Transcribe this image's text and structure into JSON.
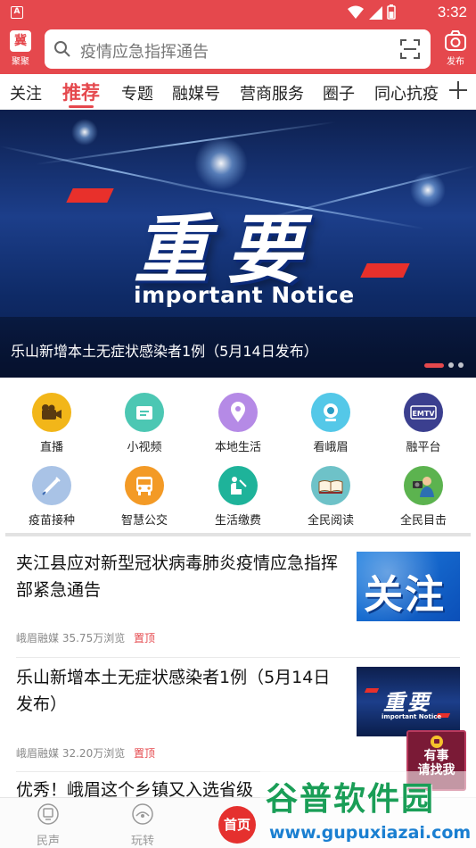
{
  "status_bar": {
    "app_badge": "A",
    "time": "3:32"
  },
  "header": {
    "logo_glyph": "冀",
    "logo_label": "聚聚",
    "search_placeholder": "疫情应急指挥通告",
    "publish_label": "发布"
  },
  "tabs": {
    "items": [
      "关注",
      "推荐",
      "专题",
      "融媒号",
      "营商服务",
      "圈子",
      "同心抗疫"
    ],
    "active": "推荐"
  },
  "banner": {
    "headline": "重要",
    "subtitle": "important Notice",
    "caption": "乐山新增本土无症状感染者1例（5月14日发布）",
    "slide_count": 3,
    "active_slide": 1
  },
  "shortcuts": [
    {
      "label": "直播",
      "icon": "camera-icon",
      "color": "#f2b619"
    },
    {
      "label": "小视频",
      "icon": "video-icon",
      "color": "#4cc7b3"
    },
    {
      "label": "本地生活",
      "icon": "location-icon",
      "color": "#b58ae6"
    },
    {
      "label": "看峨眉",
      "icon": "webcam-icon",
      "color": "#54c8e8"
    },
    {
      "label": "融平台",
      "icon": "tv-icon",
      "color": "#3b3f8f"
    },
    {
      "label": "疫苗接种",
      "icon": "syringe-icon",
      "color": "#a9c3e6"
    },
    {
      "label": "智慧公交",
      "icon": "bus-icon",
      "color": "#f39a26"
    },
    {
      "label": "生活缴费",
      "icon": "payment-icon",
      "color": "#1eb39a"
    },
    {
      "label": "全民阅读",
      "icon": "book-icon",
      "color": "#6ec2c8"
    },
    {
      "label": "全民目击",
      "icon": "reporter-icon",
      "color": "#5cb34f"
    }
  ],
  "news": [
    {
      "title": "夹江县应对新型冠状病毒肺炎疫情应急指挥部紧急通告",
      "source": "峨眉融媒",
      "views": "35.75万浏览",
      "pin": "置顶",
      "thumb_text": "关注"
    },
    {
      "title": "乐山新增本土无症状感染者1例（5月14日发布）",
      "source": "峨眉融媒",
      "views": "32.20万浏览",
      "pin": "置顶",
      "thumb_text": "重要",
      "thumb_sub": "important Notice"
    },
    {
      "title": "优秀！峨眉这个乡镇又入选省级"
    }
  ],
  "float_badge": {
    "line1": "有事",
    "line2": "请找我"
  },
  "bottom_nav": {
    "items": [
      {
        "label": "民声",
        "icon": "voice-icon"
      },
      {
        "label": "玩转",
        "icon": "explore-icon"
      }
    ],
    "home_label": "首页"
  },
  "watermark": {
    "title": "谷普软件园",
    "url": "www.gupuxiazai.com"
  }
}
